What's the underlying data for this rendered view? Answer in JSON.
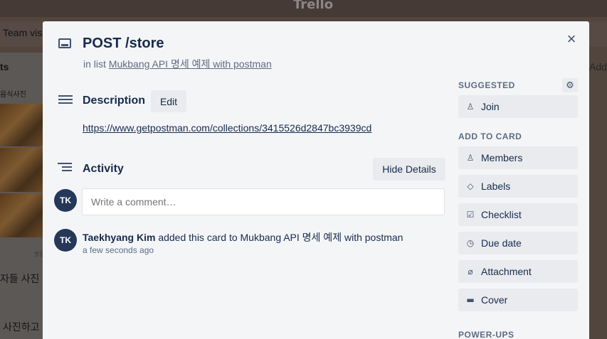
{
  "background": {
    "logo": "Trello",
    "team_visibility": "Team visi",
    "list_title": "ts",
    "card_label_1": "음식사진",
    "card_small_text": "방문",
    "card_label_2": "자들 사진",
    "card_label_3": "사진하고",
    "right_add": "Add"
  },
  "card": {
    "title": "POST /store",
    "in_list_prefix": "in list",
    "list_name": "Mukbang API 명세 예제 with postman",
    "close_icon": "×"
  },
  "description": {
    "title": "Description",
    "edit_label": "Edit",
    "link": "https://www.getpostman.com/collections/3415526d2847bc3939cd"
  },
  "activity": {
    "title": "Activity",
    "hide_details_label": "Hide Details",
    "comment_placeholder": "Write a comment…",
    "avatar_initials": "TK",
    "entries": [
      {
        "author": "Taekhyang Kim",
        "action": "added this card to Mukbang API 명세 예제 with postman",
        "time": "a few seconds ago",
        "avatar": "TK"
      }
    ]
  },
  "sidebar": {
    "suggested_heading": "SUGGESTED",
    "join_label": "Join",
    "add_to_card_heading": "ADD TO CARD",
    "items": [
      {
        "label": "Members",
        "icon": "person-icon"
      },
      {
        "label": "Labels",
        "icon": "tag-icon"
      },
      {
        "label": "Checklist",
        "icon": "checklist-icon"
      },
      {
        "label": "Due date",
        "icon": "clock-icon"
      },
      {
        "label": "Attachment",
        "icon": "paperclip-icon"
      },
      {
        "label": "Cover",
        "icon": "cover-icon"
      }
    ],
    "power_ups_heading": "POWER-UPS"
  }
}
